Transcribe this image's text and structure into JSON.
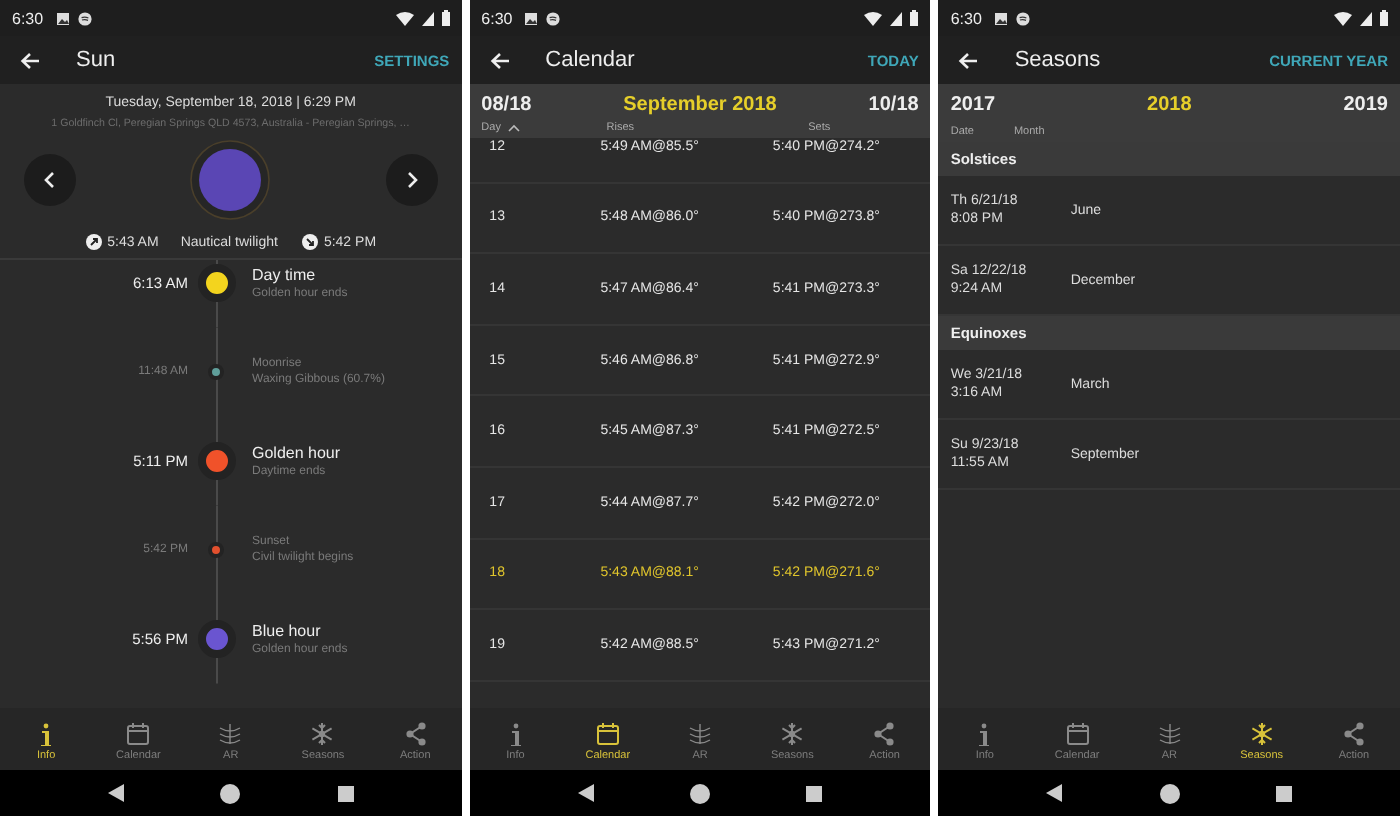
{
  "phones": [
    {
      "kind": "sun",
      "status_bar": {
        "time": "6:30"
      },
      "app_bar": {
        "title": "Sun",
        "action": "SETTINGS"
      },
      "date": "Tuesday, September 18, 2018 | 6:29 PM",
      "address": "1 Goldfinch Cl, Peregian Springs QLD 4573, Australia - Peregian Springs, …",
      "twilight": {
        "rise": "5:43 AM",
        "phase": "Nautical twilight",
        "set": "5:42 PM"
      },
      "timeline": [
        {
          "kind": "major",
          "time": "6:13 AM",
          "title": "Day time",
          "subtitle": "Golden hour ends",
          "color": "#f3d41e"
        },
        {
          "kind": "minor",
          "time": "11:48 AM",
          "title": "Moonrise",
          "subtitle": "Waxing Gibbous (60.7%)",
          "color": "#5f9e9a"
        },
        {
          "kind": "major",
          "time": "5:11 PM",
          "title": "Golden hour",
          "subtitle": "Daytime ends",
          "color": "#f0522a"
        },
        {
          "kind": "minor",
          "time": "5:42 PM",
          "title": "Sunset",
          "subtitle": "Civil twilight begins",
          "color": "#e2502e"
        },
        {
          "kind": "major",
          "time": "5:56 PM",
          "title": "Blue hour",
          "subtitle": "Golden hour ends",
          "color": "#6a55d0"
        }
      ],
      "bottom_nav": [
        {
          "label": "Info",
          "selected": true
        },
        {
          "label": "Calendar",
          "selected": false
        },
        {
          "label": "AR",
          "selected": false
        },
        {
          "label": "Seasons",
          "selected": false
        },
        {
          "label": "Action",
          "selected": false
        }
      ]
    },
    {
      "kind": "calendar",
      "status_bar": {
        "time": "6:30"
      },
      "app_bar": {
        "title": "Calendar",
        "action": "TODAY"
      },
      "header": {
        "prev": "08/18",
        "current": "September 2018",
        "next": "10/18"
      },
      "columns": [
        "Day",
        "Rises",
        "Sets"
      ],
      "rows": [
        {
          "day": "12",
          "rises": "5:49 AM@85.5°",
          "sets": "5:40 PM@274.2°",
          "selected": false
        },
        {
          "day": "13",
          "rises": "5:48 AM@86.0°",
          "sets": "5:40 PM@273.8°",
          "selected": false
        },
        {
          "day": "14",
          "rises": "5:47 AM@86.4°",
          "sets": "5:41 PM@273.3°",
          "selected": false
        },
        {
          "day": "15",
          "rises": "5:46 AM@86.8°",
          "sets": "5:41 PM@272.9°",
          "selected": false
        },
        {
          "day": "16",
          "rises": "5:45 AM@87.3°",
          "sets": "5:41 PM@272.5°",
          "selected": false
        },
        {
          "day": "17",
          "rises": "5:44 AM@87.7°",
          "sets": "5:42 PM@272.0°",
          "selected": false
        },
        {
          "day": "18",
          "rises": "5:43 AM@88.1°",
          "sets": "5:42 PM@271.6°",
          "selected": true
        },
        {
          "day": "19",
          "rises": "5:42 AM@88.5°",
          "sets": "5:43 PM@271.2°",
          "selected": false
        }
      ],
      "bottom_nav": [
        {
          "label": "Info",
          "selected": false
        },
        {
          "label": "Calendar",
          "selected": true
        },
        {
          "label": "AR",
          "selected": false
        },
        {
          "label": "Seasons",
          "selected": false
        },
        {
          "label": "Action",
          "selected": false
        }
      ]
    },
    {
      "kind": "seasons",
      "status_bar": {
        "time": "6:30"
      },
      "app_bar": {
        "title": "Seasons",
        "action": "CURRENT YEAR"
      },
      "header": {
        "prev": "2017",
        "current": "2018",
        "next": "2019"
      },
      "columns": [
        "Date",
        "Month"
      ],
      "sections": [
        {
          "title": "Solstices",
          "rows": [
            {
              "date": "Th 6/21/18",
              "time": "8:08 PM",
              "month": "June"
            },
            {
              "date": "Sa 12/22/18",
              "time": "9:24 AM",
              "month": "December"
            }
          ]
        },
        {
          "title": "Equinoxes",
          "rows": [
            {
              "date": "We 3/21/18",
              "time": "3:16 AM",
              "month": "March"
            },
            {
              "date": "Su 9/23/18",
              "time": "11:55 AM",
              "month": "September"
            }
          ]
        }
      ],
      "bottom_nav": [
        {
          "label": "Info",
          "selected": false
        },
        {
          "label": "Calendar",
          "selected": false
        },
        {
          "label": "AR",
          "selected": false
        },
        {
          "label": "Seasons",
          "selected": true
        },
        {
          "label": "Action",
          "selected": false
        }
      ]
    }
  ]
}
